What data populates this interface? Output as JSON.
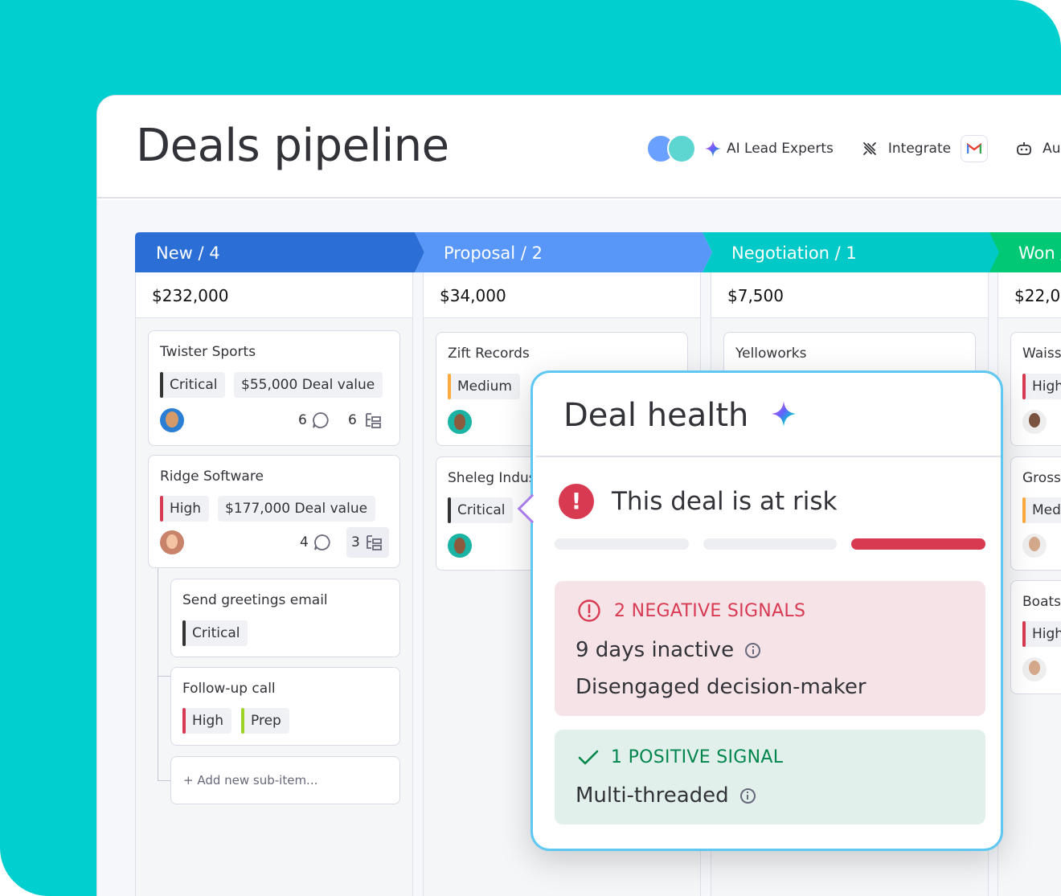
{
  "header": {
    "title": "Deals pipeline",
    "ai_lead_label": "AI Lead Experts",
    "integrate_label": "Integrate",
    "automate_label": "Aut"
  },
  "columns": [
    {
      "title": "New / 4",
      "sum": "$232,000",
      "color": "#2B6FD6"
    },
    {
      "title": "Proposal / 2",
      "sum": "$34,000",
      "color": "#5897F7"
    },
    {
      "title": "Negotiation / 1",
      "sum": "$7,500",
      "color": "#00C9C8"
    },
    {
      "title": "Won /",
      "sum": "$22,0",
      "color": "#00C875"
    }
  ],
  "cards": {
    "twister": {
      "title": "Twister Sports",
      "priority": "Critical",
      "deal": "$55,000 Deal value",
      "comments": "6",
      "subitems": "6"
    },
    "ridge": {
      "title": "Ridge Software",
      "priority": "High",
      "deal": "$177,000  Deal value",
      "comments": "4",
      "subitems": "3"
    },
    "greet": {
      "title": "Send greetings email",
      "priority": "Critical"
    },
    "followup": {
      "title": "Follow-up call",
      "priority": "High",
      "stage": "Prep"
    },
    "add_sub": "+ Add new sub-item...",
    "zift": {
      "title": "Zift Records",
      "priority": "Medium"
    },
    "sheleg": {
      "title": "Sheleg Indus",
      "priority": "Critical"
    },
    "yelloworks": {
      "title": "Yelloworks"
    },
    "waiss": {
      "title": "Waiss",
      "priority": "High"
    },
    "gross": {
      "title": "Gross",
      "priority": "Med"
    },
    "boats": {
      "title": "Boats",
      "priority": "High"
    }
  },
  "priority_colors": {
    "critical": "#333333",
    "high": "#D83A52",
    "medium": "#FDAB3D",
    "prep": "#9CD326"
  },
  "deal_health": {
    "title": "Deal health",
    "status": "This deal is at risk",
    "risk_level": 3,
    "risk_segments": 3,
    "negative_header": "2 NEGATIVE SIGNALS",
    "negative_signals": [
      "9 days inactive",
      "Disengaged decision-maker"
    ],
    "positive_header": "1 POSITIVE SIGNAL",
    "positive_signals": [
      "Multi-threaded"
    ]
  }
}
